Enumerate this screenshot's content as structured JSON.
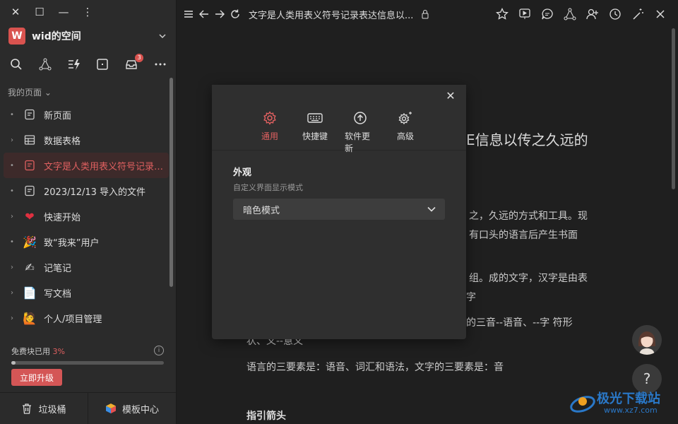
{
  "window_controls": {
    "close": "✕",
    "maximize": "☐",
    "minimize": "—",
    "more": "⋮"
  },
  "workspace": {
    "initial": "W",
    "name": "wid的空间",
    "avatar_color": "#d9534f"
  },
  "toolbar": {
    "inbox_badge": "3"
  },
  "section": {
    "label": "我的页面"
  },
  "nav": [
    {
      "label": "新页面",
      "lead": "•",
      "icon": "page-icon"
    },
    {
      "label": "数据表格",
      "lead": "›",
      "icon": "table-icon"
    },
    {
      "label": "文字是人类用表义符号记录…",
      "lead": "•",
      "icon": "page-icon",
      "active": true
    },
    {
      "label": "2023/12/13 导入的文件",
      "lead": "•",
      "icon": "page-icon"
    },
    {
      "label": "快速开始",
      "lead": "›",
      "icon": "heart-icon",
      "glyph": "❤"
    },
    {
      "label": "致“我来”用户",
      "lead": "•",
      "icon": "party-icon",
      "glyph": "🎉"
    },
    {
      "label": "记笔记",
      "lead": "›",
      "icon": "writing-hand-icon",
      "glyph": "✍"
    },
    {
      "label": "写文档",
      "lead": "›",
      "icon": "document-icon",
      "glyph": "📄"
    },
    {
      "label": "个人/项目管理",
      "lead": "›",
      "icon": "person-icon",
      "glyph": "🙋"
    }
  ],
  "quota": {
    "label": "免费块已用",
    "percent": "3%",
    "fraction": 0.03,
    "upgrade_label": "立即升级"
  },
  "bottom": {
    "trash": "垃圾桶",
    "templates": "模板中心"
  },
  "doc": {
    "title": "文字是人类用表义符号记录表达信息以...",
    "heading_fragment": "E信息以传之久远的",
    "paragraphs": [
      "之，久远的方式和工具。现",
      "有口头的语言后产生书面",
      "组。成的文字，汉字是由表",
      "字",
      "的三音--语音、--字 符形",
      "状、义--意义",
      "语言的三要素是：语音、词汇和语法，文字的三要素是：音",
      "指引箭头"
    ]
  },
  "dialog": {
    "tabs": [
      {
        "label": "通用",
        "icon": "gear-icon",
        "active": true
      },
      {
        "label": "快捷键",
        "icon": "keyboard-icon"
      },
      {
        "label": "软件更新",
        "icon": "update-icon"
      },
      {
        "label": "高级",
        "icon": "advanced-gear-icon"
      }
    ],
    "section_title": "外观",
    "section_subtitle": "自定义界面显示模式",
    "select_value": "暗色模式",
    "close": "✕"
  },
  "help": "?",
  "watermark": {
    "text": "极光下载站",
    "url": "www.xz7.com"
  },
  "colors": {
    "accent": "#e06060",
    "sidebar_bg": "#2b2b2b",
    "main_bg": "#1f1f1f"
  }
}
